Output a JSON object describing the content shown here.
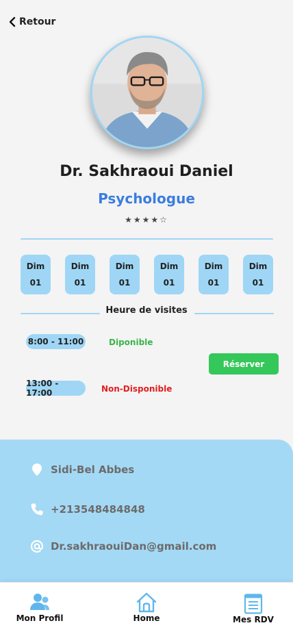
{
  "header": {
    "back_label": "Retour"
  },
  "doctor": {
    "name": "Dr. Sakhraoui Daniel",
    "specialty": "Psychologue",
    "rating": {
      "value": 4,
      "max": 5,
      "stars_text": "★★★★☆"
    }
  },
  "days": [
    {
      "day": "Dim",
      "date": "01"
    },
    {
      "day": "Dim",
      "date": "01"
    },
    {
      "day": "Dim",
      "date": "01"
    },
    {
      "day": "Dim",
      "date": "01"
    },
    {
      "day": "Dim",
      "date": "01"
    },
    {
      "day": "Dim",
      "date": "01"
    }
  ],
  "visits": {
    "title": "Heure de visites",
    "slots": [
      {
        "time": "8:00 - 11:00",
        "status": "Diponible",
        "status_color": "#3cb44b"
      },
      {
        "time": "13:00 - 17:00",
        "status": "Non-Disponible",
        "status_color": "#e01e1e"
      }
    ],
    "reserve_label": "Réserver"
  },
  "contact": {
    "address": "Sidi-Bel Abbes",
    "phone": "+213548484848",
    "email": "Dr.sakhraouiDan@gmail.com"
  },
  "nav": {
    "profile": "Mon Profil",
    "home": "Home",
    "appointments": "Mes RDV"
  },
  "colors": {
    "accent_light_blue": "#9fd6f5",
    "specialty_blue": "#3b7de0",
    "reserve_green": "#34c759",
    "icon_blue": "#5fb6ec"
  },
  "icons": {
    "back": "chevron-left-icon",
    "address": "location-pin-icon",
    "phone": "phone-icon",
    "email": "at-sign-icon",
    "nav_profile": "users-icon",
    "nav_home": "home-icon",
    "nav_appointments": "document-list-icon"
  }
}
